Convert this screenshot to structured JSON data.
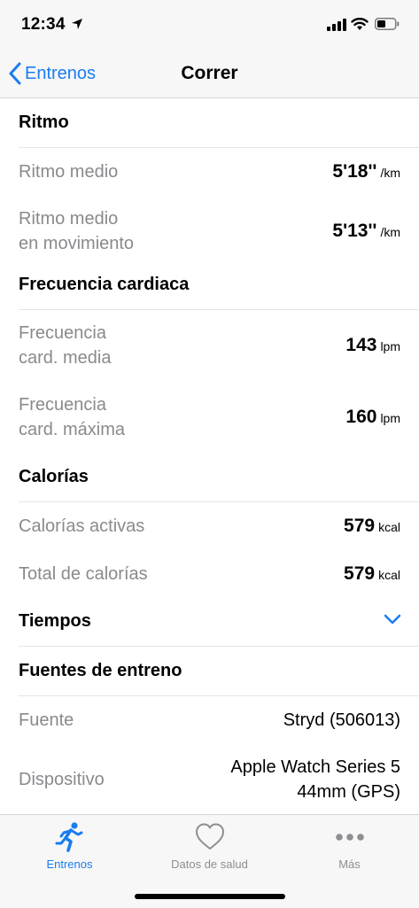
{
  "status_bar": {
    "time": "12:34"
  },
  "nav": {
    "back_label": "Entrenos",
    "title": "Correr"
  },
  "sections": {
    "ritmo": {
      "title": "Ritmo",
      "avg_label": "Ritmo medio",
      "avg_value": "5'18''",
      "avg_unit": "/km",
      "moving_label_line1": "Ritmo medio",
      "moving_label_line2": "en movimiento",
      "moving_value": "5'13''",
      "moving_unit": "/km"
    },
    "frecuencia": {
      "title": "Frecuencia cardiaca",
      "avg_label_line1": "Frecuencia",
      "avg_label_line2": "card. media",
      "avg_value": "143",
      "avg_unit": "lpm",
      "max_label_line1": "Frecuencia",
      "max_label_line2": "card. máxima",
      "max_value": "160",
      "max_unit": "lpm"
    },
    "calorias": {
      "title": "Calorías",
      "active_label": "Calorías activas",
      "active_value": "579",
      "active_unit": "kcal",
      "total_label": "Total de calorías",
      "total_value": "579",
      "total_unit": "kcal"
    },
    "tiempos": {
      "title": "Tiempos"
    },
    "fuentes": {
      "title": "Fuentes de entreno",
      "source_label": "Fuente",
      "source_value": "Stryd (506013)",
      "device_label": "Dispositivo",
      "device_value_line1": "Apple Watch Series 5",
      "device_value_line2": "44mm (GPS)"
    }
  },
  "tab_bar": {
    "tabs": [
      {
        "label": "Entrenos",
        "icon": "running-figure-icon",
        "active": true
      },
      {
        "label": "Datos de salud",
        "icon": "heart-icon",
        "active": false
      },
      {
        "label": "Más",
        "icon": "more-dots-icon",
        "active": false
      }
    ]
  },
  "colors": {
    "accent": "#1a7cf0",
    "inactive_tab": "#8e8e93",
    "secondary_text": "#8a8a8e",
    "background": "#f7f7f7"
  }
}
